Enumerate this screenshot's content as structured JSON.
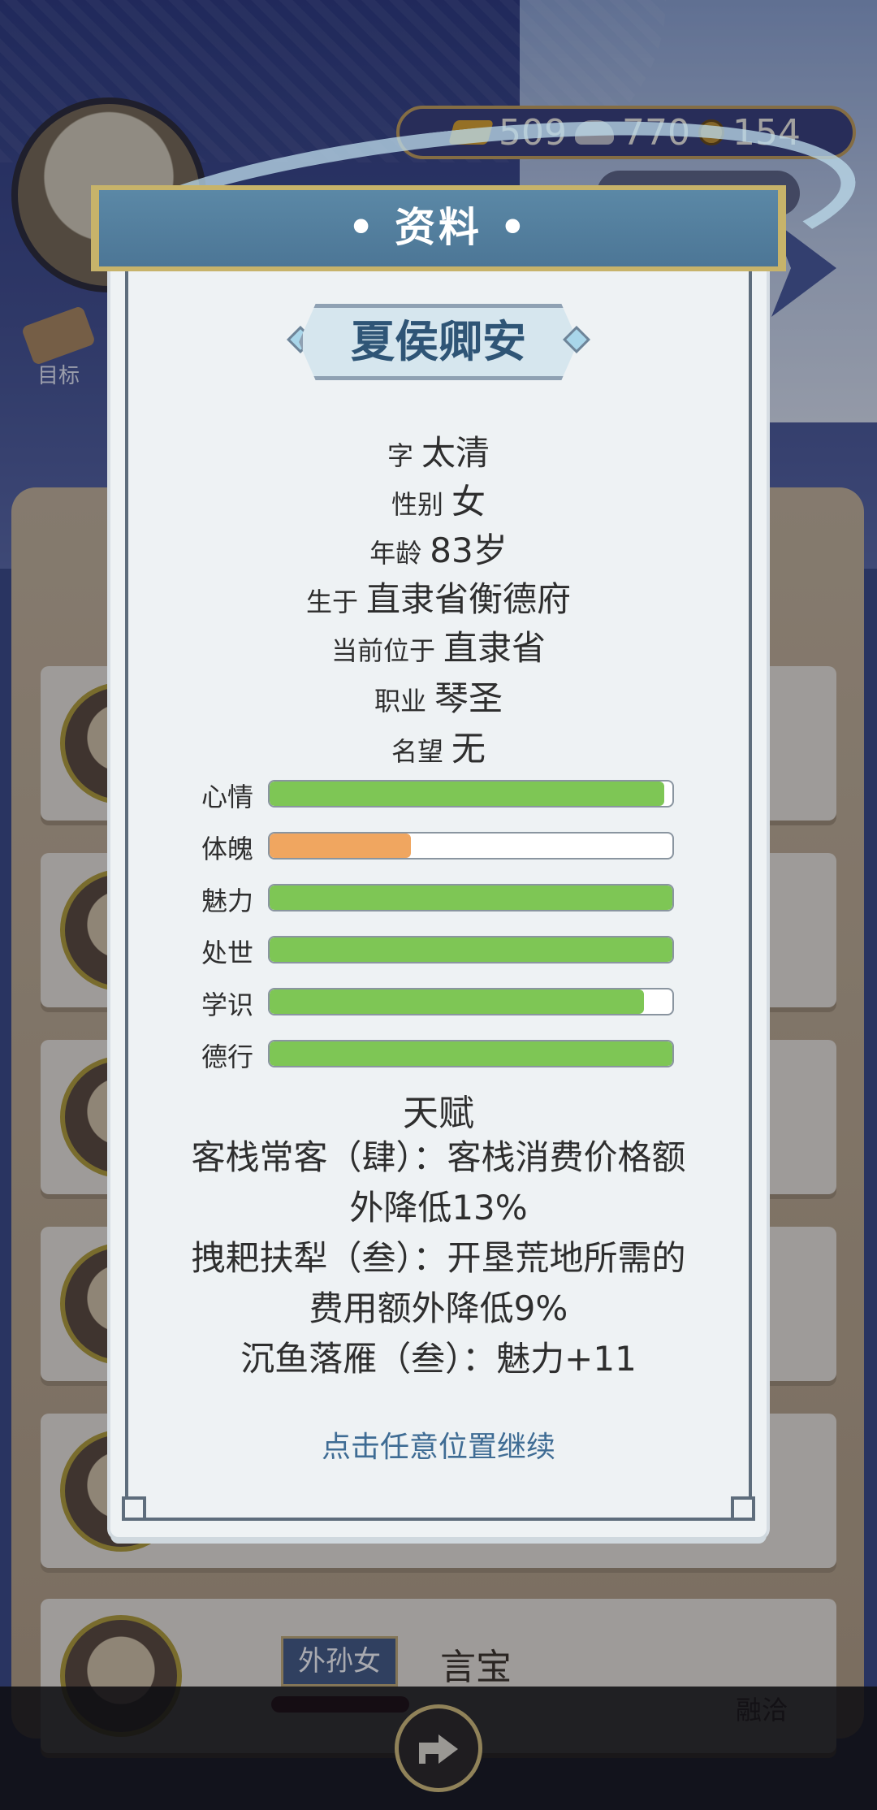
{
  "currency": {
    "gold": "509",
    "silver": "770",
    "coin": "154"
  },
  "goal_label": "目标",
  "modal": {
    "title": "• 资料 •",
    "name": "夏侯卿安",
    "details": [
      {
        "label": "字",
        "value": "太清"
      },
      {
        "label": "性别",
        "value": "女"
      },
      {
        "label": "年龄",
        "value": "83岁"
      },
      {
        "label": "生于",
        "value": "直隶省衡德府"
      },
      {
        "label": "当前位于",
        "value": "直隶省"
      },
      {
        "label": "职业",
        "value": "琴圣"
      },
      {
        "label": "名望",
        "value": "无"
      }
    ],
    "stats": [
      {
        "label": "心情",
        "level": 0.98,
        "color": "#7ec655"
      },
      {
        "label": "体魄",
        "level": 0.35,
        "color": "#f0a660"
      },
      {
        "label": "魅力",
        "level": 1.0,
        "color": "#7ec655"
      },
      {
        "label": "处世",
        "level": 1.0,
        "color": "#7ec655"
      },
      {
        "label": "学识",
        "level": 0.93,
        "color": "#7ec655"
      },
      {
        "label": "德行",
        "level": 1.0,
        "color": "#7ec655"
      }
    ],
    "talent_title": "天赋",
    "talent_lines": [
      "客栈常客（肆）：客栈消费价格额",
      "外降低13%",
      "拽耙扶犁（叁）：开垦荒地所需的",
      "费用额外降低9%",
      "沉鱼落雁（叁）：魅力+11"
    ],
    "continue_hint": "点击任意位置继续"
  },
  "bottom_member": {
    "relation": "外孙女",
    "name": "言宝",
    "status": "融洽"
  }
}
